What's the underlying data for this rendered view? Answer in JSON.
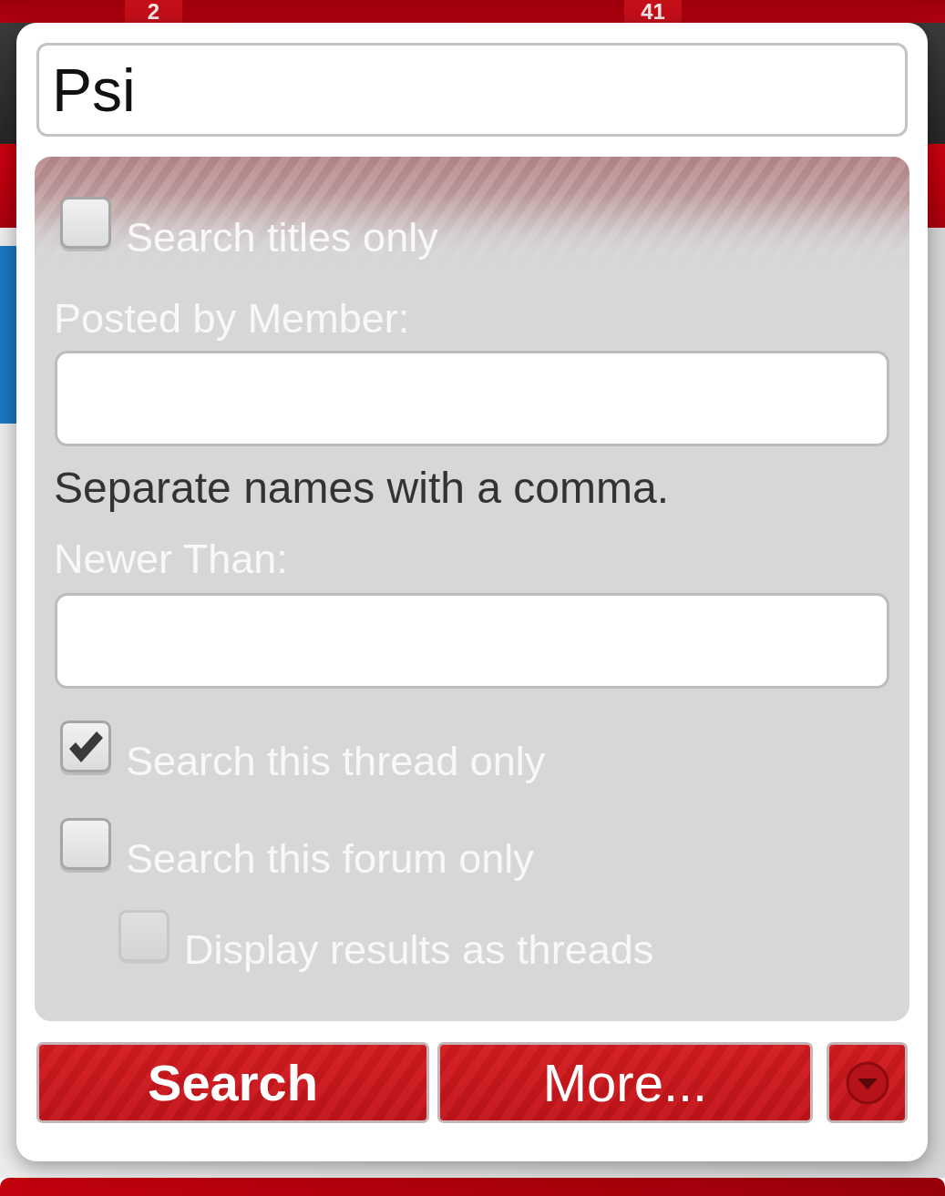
{
  "background": {
    "badges": [
      "2",
      "41"
    ]
  },
  "popup": {
    "query": {
      "value": "Psi"
    },
    "title_option": {
      "label": "Search titles only",
      "checked": false
    },
    "member_field": {
      "label": "Posted by Member:",
      "hint": "Separate names with a comma."
    },
    "date_field": {
      "label": "Newer Than:"
    },
    "scope_options": [
      {
        "label": "Search this thread only",
        "checked": true,
        "disabled": false
      },
      {
        "label": "Search this forum only",
        "checked": false,
        "disabled": false,
        "children": [
          {
            "label": "Display results as threads",
            "checked": false,
            "disabled": true
          }
        ]
      }
    ],
    "buttons": [
      {
        "label": "Search",
        "kind": "primary"
      },
      {
        "label": "More...",
        "kind": "secondary"
      }
    ]
  }
}
